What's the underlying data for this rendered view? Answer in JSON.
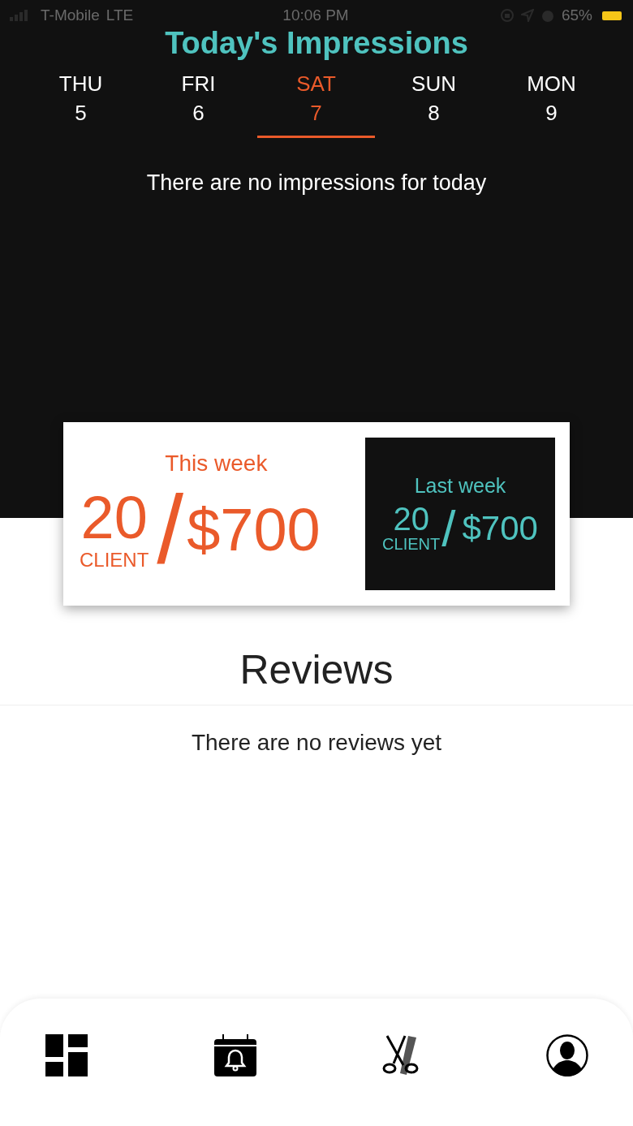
{
  "status_bar": {
    "carrier": "T-Mobile",
    "network": "LTE",
    "time": "10:06 PM",
    "battery": "65%"
  },
  "title": "Today's Impressions",
  "days": [
    {
      "name": "THU",
      "date": "5",
      "selected": false
    },
    {
      "name": "FRI",
      "date": "6",
      "selected": false
    },
    {
      "name": "SAT",
      "date": "7",
      "selected": true
    },
    {
      "name": "SUN",
      "date": "8",
      "selected": false
    },
    {
      "name": "MON",
      "date": "9",
      "selected": false
    }
  ],
  "impressions_message": "There are no impressions for today",
  "stats": [
    {
      "kind": "current",
      "label": "This week",
      "clients": "20",
      "client_label": "CLIENT",
      "separator": "/",
      "amount": "$700"
    },
    {
      "kind": "previous",
      "label": "Last week",
      "clients": "20",
      "client_label": "CLIENT",
      "separator": "/",
      "amount": "$700"
    }
  ],
  "reviews": {
    "heading": "Reviews",
    "message": "There are no reviews yet"
  },
  "nav": [
    {
      "kind": "dashboard"
    },
    {
      "kind": "calendar"
    },
    {
      "kind": "scissors"
    },
    {
      "kind": "profile"
    }
  ]
}
